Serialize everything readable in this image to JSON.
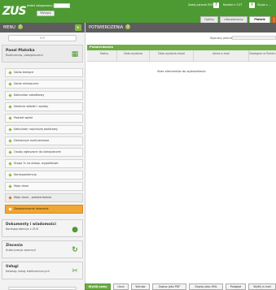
{
  "header": {
    "logo": "ZUS",
    "logged_in_label": "Jesteś zalogowany jako:",
    "logout_label": "Wyloguj",
    "utilities": [
      {
        "label": "Zadaj pytanie ZUS",
        "icon": "question-mail-icon"
      },
      {
        "label": "Kontakt z COT",
        "icon": "info-icon"
      },
      {
        "label": "Skype z ..."
      }
    ],
    "tabs": [
      {
        "label": "Ogólny",
        "active": false
      },
      {
        "label": "Ubezpieczony",
        "active": false
      },
      {
        "label": "Płatnik",
        "active": true
      }
    ]
  },
  "sidebar": {
    "title": "MENU",
    "search_label": "<<",
    "section": {
      "title": "Panel Płatnika",
      "subtitle": "Rozliczenia, ubezpieczeni",
      "icon": "document-grid-icon"
    },
    "items": [
      {
        "label": "Saldo bieżące",
        "kind": "plain"
      },
      {
        "label": "Saldo miesięczne",
        "kind": "plain"
      },
      {
        "label": "Kalkulator odsetkowy",
        "kind": "plain"
      },
      {
        "label": "Należne składki i wpłaty",
        "kind": "plain"
      },
      {
        "label": "Podział wpłat",
        "kind": "plain"
      },
      {
        "label": "Kalkulator najniższej podstawy",
        "kind": "plain"
      },
      {
        "label": "Deklaracje rozliczeniowe",
        "kind": "plain"
      },
      {
        "label": "Osoby zgłoszone do ubezpieczeń",
        "kind": "plain"
      },
      {
        "label": "Stopa % na ubezp. wypadkowe",
        "kind": "plain"
      },
      {
        "label": "Korespondencja",
        "kind": "plain"
      },
      {
        "label": "Moje dane",
        "kind": "plain"
      },
      {
        "label": "Moje dane - potwierdzenia",
        "kind": "sub"
      },
      {
        "label": "Zaświadczenie lekarskie",
        "kind": "selected"
      }
    ],
    "sections_bottom": [
      {
        "title": "Dokumenty i wiadomości",
        "subtitle": "Korespondencja z ZUS",
        "icon": "speech-bubble-icon"
      },
      {
        "title": "Zlecenia",
        "subtitle": "Autoryzacja operacji",
        "icon": "refresh-icon"
      },
      {
        "title": "Usługi",
        "subtitle": "Katalog usług elektronicznych",
        "icon": "tools-icon"
      }
    ]
  },
  "main": {
    "title": "POTWIERDZENIA",
    "payer_label": "Wybrany płatnik:",
    "panel_title": "Potwierdzenia",
    "columns": [
      "Status",
      "Data wydania",
      "Data wydania email",
      "Adres e-mail",
      "Dostępne w Portalu"
    ],
    "empty_message": "Brak elementów do wyświetlenia",
    "buttons": [
      {
        "label": "Wyślij nowy",
        "primary": true
      },
      {
        "label": "Usuń",
        "primary": false
      },
      {
        "label": "Wznów",
        "primary": false
      },
      {
        "label": "Zapisz jako PDF",
        "primary": false
      },
      {
        "label": "Zapisz jako XML",
        "primary": false
      },
      {
        "label": "Podgląd",
        "primary": false
      },
      {
        "label": "Wyślij e-mail",
        "primary": false
      }
    ]
  },
  "colors": {
    "brand_green": "#4d9a33",
    "panel_green": "#6fad44",
    "selected_orange": "#f0a734",
    "dark_bar": "#5d5d5d"
  }
}
